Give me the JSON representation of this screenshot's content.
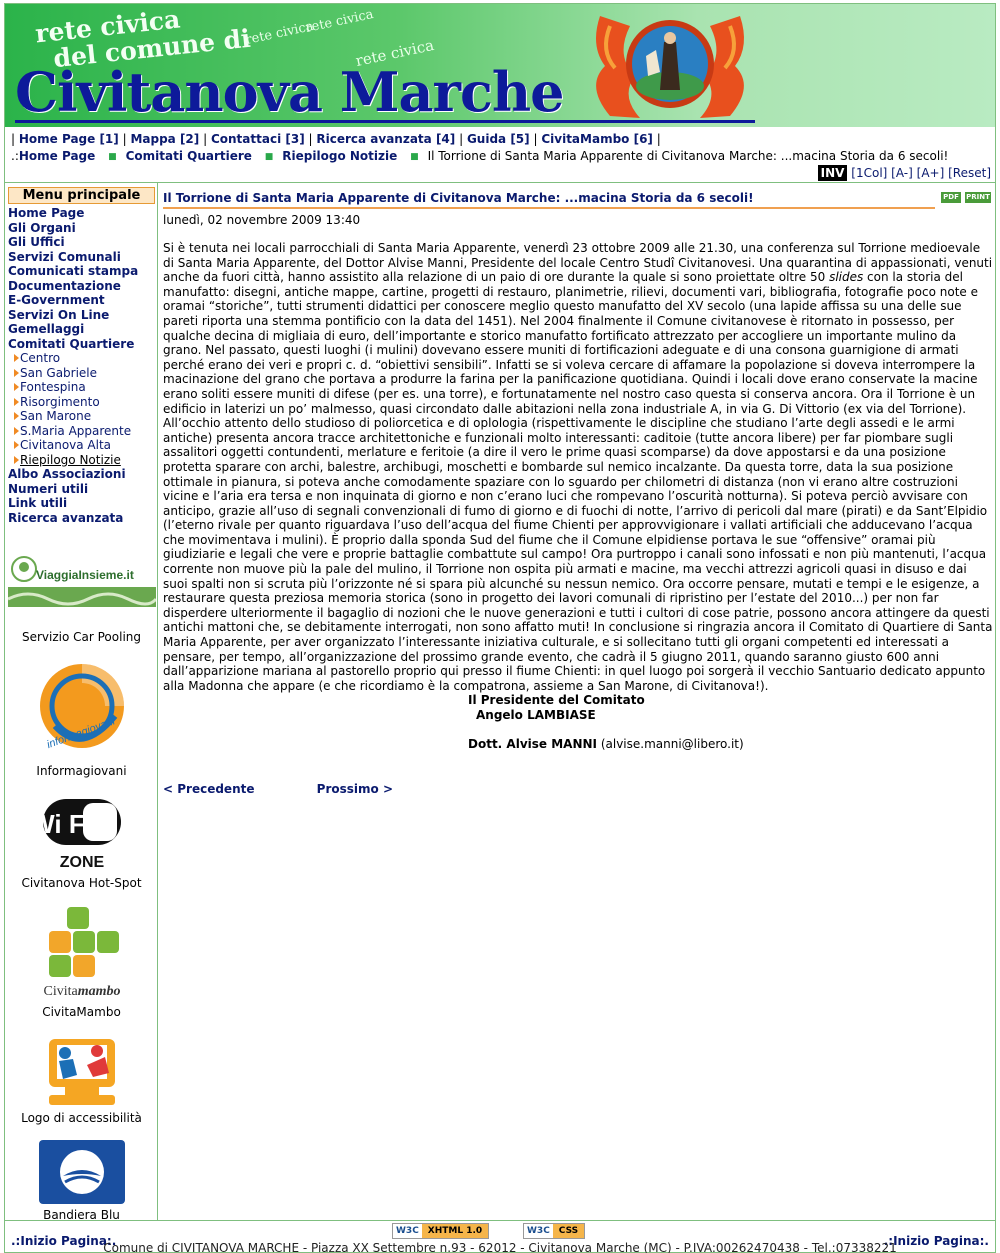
{
  "header": {
    "line1": "rete civica",
    "line2": "del comune di",
    "small": "rete civica",
    "city": "Civitanova Marche"
  },
  "topnav": {
    "items": [
      "Home Page [1]",
      "Mappa [2]",
      "Contattaci [3]",
      "Ricerca avanzata [4]",
      "Guida [5]",
      "CivitaMambo [6]"
    ]
  },
  "breadcrumb": {
    "prefix": ".:",
    "home": "Home Page",
    "item1": "Comitati Quartiere",
    "item2": "Riepilogo Notizie",
    "current": "Il Torrione di Santa Maria Apparente di Civitanova Marche: ...macina Storia da 6 secoli!"
  },
  "fontctl": {
    "inv": "INV",
    "onecol": "[1Col]",
    "smaller": "[A-]",
    "larger": "[A+]",
    "reset": "[Reset]"
  },
  "menu": {
    "title": "Menu principale",
    "items": [
      {
        "label": "Home Page",
        "sub": false
      },
      {
        "label": "Gli Organi",
        "sub": false
      },
      {
        "label": "Gli Uffici",
        "sub": false
      },
      {
        "label": "Servizi Comunali",
        "sub": false
      },
      {
        "label": "Comunicati stampa",
        "sub": false
      },
      {
        "label": "Documentazione",
        "sub": false
      },
      {
        "label": "E-Government",
        "sub": false
      },
      {
        "label": "Servizi On Line",
        "sub": false
      },
      {
        "label": "Gemellaggi",
        "sub": false
      },
      {
        "label": "Comitati Quartiere",
        "sub": false
      },
      {
        "label": "Centro",
        "sub": true
      },
      {
        "label": "San Gabriele",
        "sub": true
      },
      {
        "label": "Fontespina",
        "sub": true
      },
      {
        "label": "Risorgimento",
        "sub": true
      },
      {
        "label": "San Marone",
        "sub": true
      },
      {
        "label": "S.Maria Apparente",
        "sub": true
      },
      {
        "label": "Civitanova Alta",
        "sub": true
      },
      {
        "label": "Riepilogo Notizie",
        "sub": true,
        "active": true
      },
      {
        "label": "Albo Associazioni",
        "sub": false
      },
      {
        "label": "Numeri utili",
        "sub": false
      },
      {
        "label": "Link utili",
        "sub": false
      },
      {
        "label": "Ricerca avanzata",
        "sub": false
      }
    ]
  },
  "side": {
    "viaggia_logo": "ViaggiaInsieme.it",
    "carpool": "Servizio Car Pooling",
    "informagiovani_logo": "informagiovani",
    "informagiovani": "Informagiovani",
    "wifi_logo": "Wi Fi",
    "wifi_zone": "ZONE",
    "hotspot": "Civitanova Hot-Spot",
    "civitamambo_logo_a": "Civita",
    "civitamambo_logo_b": "mambo",
    "civitamambo": "CivitaMambo",
    "accessibilita": "Logo di accessibilità",
    "bandiera": "Bandiera Blu"
  },
  "article": {
    "title": "Il Torrione di Santa Maria Apparente di Civitanova Marche: ...macina Storia da 6 secoli!",
    "pdf": "PDF",
    "print": "PRINT",
    "date": "lunedì, 02 novembre 2009 13:40",
    "p1a": "Si è tenuta nei locali parrocchiali di Santa Maria Apparente, venerdì 23 ottobre 2009 alle 21.30, una conferenza sul Torrione medioevale di Santa Maria Apparente, del Dottor Alvise Manni, Presidente del locale Centro Studî Civitanovesi. Una quarantina di appassionati, venuti anche da fuori città, hanno assistito alla relazione di un paio di ore durante la quale si sono proiettate oltre 50 ",
    "p1em": "slides",
    "p1b": " con la storia del manufatto: disegni, antiche mappe, cartine, progetti di restauro, planimetrie, rilievi, documenti vari, bibliografia, fotografie poco note e oramai “storiche”, tutti strumenti didattici per conoscere meglio questo manufatto del XV secolo (una lapide affissa su una delle sue pareti riporta una stemma pontificio con la data del 1451). Nel 2004 finalmente il Comune civitanovese è ritornato in possesso, per qualche decina di migliaia di euro, dell’importante e storico manufatto fortificato attrezzato per accogliere un importante mulino da grano. Nel passato, questi luoghi (i mulini) dovevano essere muniti di fortificazioni adeguate e di una consona guarnigione di armati perché erano dei veri e propri c. d. “obiettivi sensibili”. Infatti se si voleva cercare di affamare la popolazione si doveva interrompere la macinazione del grano che portava a produrre la farina per la panificazione quotidiana. Quindi i locali dove erano conservate la macine erano soliti essere muniti di difese (per es. una torre), e fortunatamente nel nostro caso questa si conserva ancora. Ora il Torrione è un edificio in laterizi un po’ malmesso, quasi circondato dalle abitazioni nella zona industriale A, in via G. Di Vittorio (ex via del Torrione).",
    "p2": "All’occhio attento dello studioso di poliorcetica e di oplologia (rispettivamente le discipline che studiano l’arte degli assedi e le armi antiche) presenta ancora tracce architettoniche e funzionali molto interessanti: caditoie (tutte ancora libere) per far piombare sugli assalitori oggetti contundenti, merlature e feritoie (a dire il vero le prime quasi scomparse) da dove appostarsi e da una posizione protetta sparare con archi, balestre, archibugi, moschetti e bombarde sul nemico incalzante. Da questa torre, data la sua posizione ottimale in pianura, si poteva anche comodamente spaziare con lo sguardo per chilometri di distanza (non vi erano altre costruzioni vicine e l’aria era tersa e non inquinata di giorno e non c’erano luci che rompevano l’oscurità notturna). Si poteva perciò avvisare con anticipo, grazie all’uso di segnali convenzionali di fumo di giorno e di fuochi di notte, l’arrivo di pericoli dal mare (pirati) e da Sant’Elpidio (l’eterno rivale per quanto riguardava l’uso dell’acqua del fiume Chienti per approvvigionare i vallati artificiali che adducevano l’acqua che movimentava i mulini). È proprio dalla sponda Sud del fiume che il Comune elpidiense portava le sue “offensive” oramai più giudiziarie e legali che vere e proprie battaglie combattute sul campo! Ora purtroppo i canali sono infossati e non più mantenuti, l’acqua corrente non muove più la pale del mulino, il Torrione non ospita più armati e macine, ma vecchi attrezzi agricoli quasi in disuso e dai suoi spalti non si scruta più l’orizzonte né si spara più alcunché su nessun nemico. Ora occorre pensare, mutati e tempi e le esigenze, a restaurare questa preziosa memoria storica (sono in progetto dei lavori comunali di ripristino per l’estate del 2010...) per non far disperdere ulteriormente il bagaglio di nozioni che le nuove generazioni e tutti i cultori di cose patrie, possono ancora attingere da questi antichi mattoni che, se debitamente interrogati, non sono affatto muti! In conclusione si ringrazia ancora il Comitato di Quartiere di Santa Maria Apparente, per aver organizzato l’interessante iniziativa culturale, e si sollecitano tutti gli organi competenti ed interessati a pensare, per tempo, all’organizzazione del prossimo grande evento, che cadrà il 5 giugno 2011, quando saranno giusto 600 anni dall’apparizione mariana al pastorello proprio qui presso il fiume Chienti: in quel luogo poi sorgerà il vecchio Santuario dedicato appunto alla Madonna che appare (e che ricordiamo è la compatrona, assieme a San Marone, di Civitanova!).",
    "sign1": "Il Presidente del Comitato",
    "sign2": "Angelo LAMBIASE",
    "sign3": "Dott. Alvise MANNI",
    "sign3_email": "(alvise.manni@libero.it)",
    "prev": "< Precedente",
    "next": "Prossimo >"
  },
  "footer": {
    "top_link": ".:Inizio Pagina:.",
    "xhtml_a": "W3C",
    "xhtml_b": "XHTML 1.0",
    "css_a": "W3C",
    "css_b": "CSS",
    "address": "Comune di CIVITANOVA MARCHE - Piazza XX Settembre n.93 - 62012 - Civitanova Marche (MC) - P.IVA:00262470438 - Tel.:07338221"
  }
}
